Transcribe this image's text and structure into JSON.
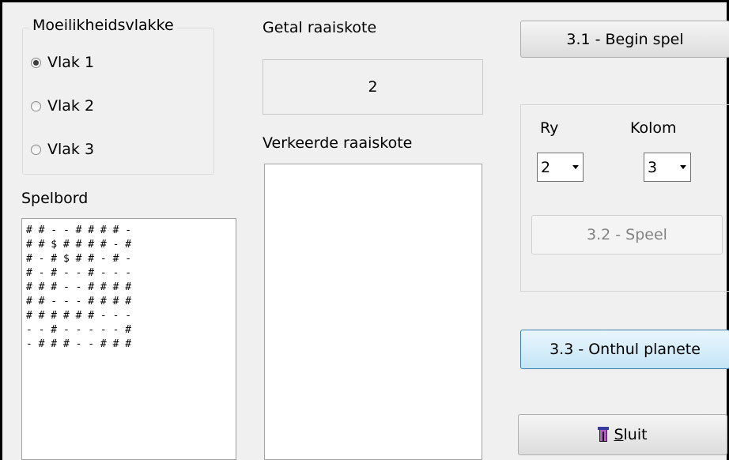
{
  "difficulty": {
    "title": "Moeilikheidsvlakke",
    "options": [
      {
        "label": "Vlak 1",
        "selected": true
      },
      {
        "label": "Vlak 2",
        "selected": false
      },
      {
        "label": "Vlak 3",
        "selected": false
      }
    ]
  },
  "board": {
    "label": "Spelbord",
    "rows": [
      "# # - - # # # # -",
      "# # $ # # # # - #",
      "# - # $ # # - # -",
      "# - # - - # - - -",
      "# # # - - # # # #",
      "# # - - - # # # #",
      "# # # # # # - - -",
      "- - # - - - - - #",
      "- # # # - - # # #"
    ]
  },
  "guesses": {
    "label": "Getal raaiskote",
    "value": "2"
  },
  "wrong_guesses": {
    "label": "Verkeerde raaiskote",
    "items": []
  },
  "buttons": {
    "begin": "3.1 - Begin spel",
    "play": "3.2 - Speel",
    "reveal": "3.3 - Onthul planete",
    "close_mnemonic": "S",
    "close_rest": "luit"
  },
  "selection": {
    "row_label": "Ry",
    "row_value": "2",
    "col_label": "Kolom",
    "col_value": "3"
  },
  "icons": {
    "close": "exit-door-icon"
  },
  "colors": {
    "background": "#f0f0f0",
    "focus_border": "#3c7fb1",
    "disabled_text": "#838383"
  }
}
